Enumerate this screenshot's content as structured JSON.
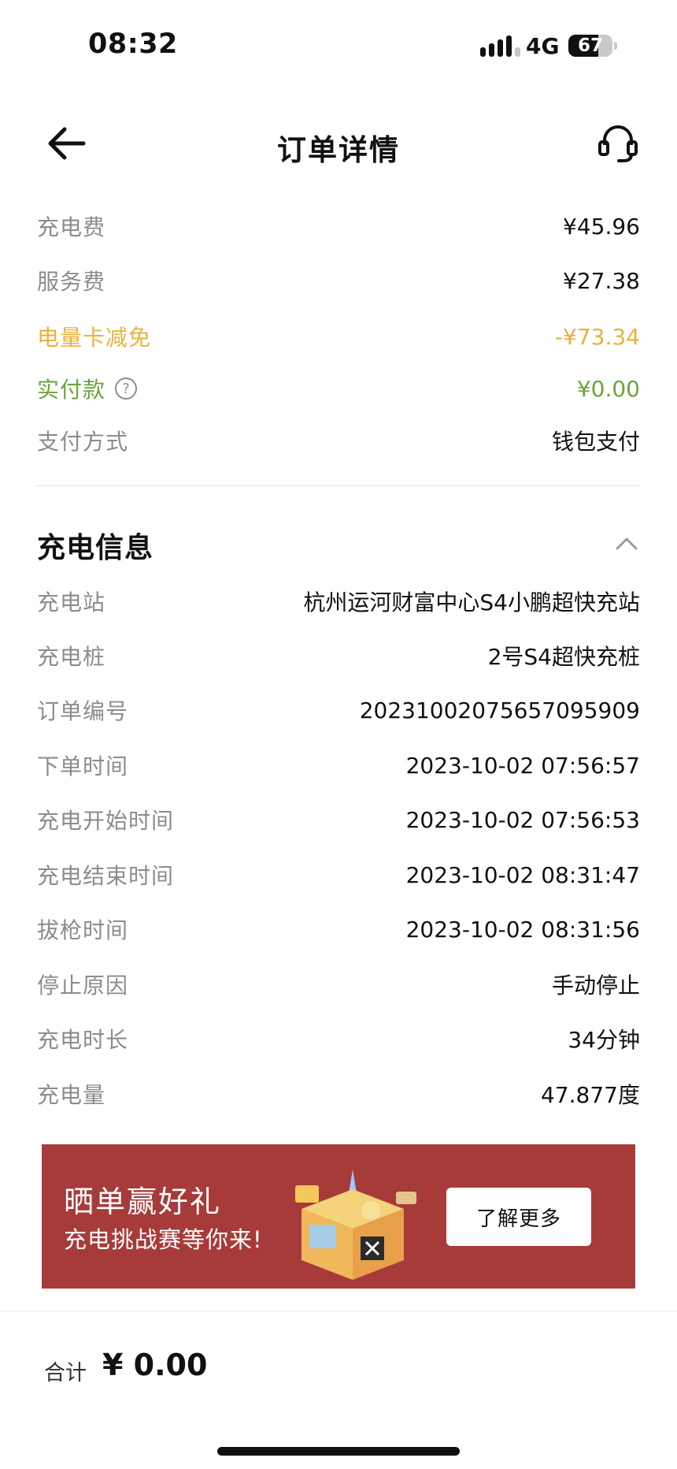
{
  "status_bar": {
    "time": "08:32",
    "network": "4G",
    "battery": "67",
    "battery_level": 0.67
  },
  "nav": {
    "title": "订单详情",
    "back_icon": "arrow-left-icon",
    "service_icon": "headset-icon"
  },
  "fees": {
    "charge_fee": {
      "label": "充电费",
      "value": "¥45.96"
    },
    "service_fee": {
      "label": "服务费",
      "value": "¥27.38"
    },
    "discount": {
      "label": "电量卡减免",
      "value": "-¥73.34"
    },
    "paid": {
      "label": "实付款",
      "value": "¥0.00",
      "help_icon": "question-circle-icon",
      "help_glyph": "?"
    },
    "payment_method": {
      "label": "支付方式",
      "value": "钱包支付"
    }
  },
  "charging_info": {
    "title": "充电信息",
    "collapse_icon": "chevron-up-icon",
    "rows": [
      {
        "label": "充电站",
        "value": "杭州运河财富中心S4小鹏超快充站"
      },
      {
        "label": "充电桩",
        "value": "2号S4超快充桩"
      },
      {
        "label": "订单编号",
        "value": "20231002075657095909"
      },
      {
        "label": "下单时间",
        "value": "2023-10-02 07:56:57"
      },
      {
        "label": "充电开始时间",
        "value": "2023-10-02 07:56:53"
      },
      {
        "label": "充电结束时间",
        "value": "2023-10-02 08:31:47"
      },
      {
        "label": "拔枪时间",
        "value": "2023-10-02 08:31:56"
      },
      {
        "label": "停止原因",
        "value": "手动停止"
      },
      {
        "label": "充电时长",
        "value": "34分钟"
      },
      {
        "label": "充电量",
        "value": "47.877度"
      }
    ]
  },
  "banner": {
    "title": "晒单赢好礼",
    "subtitle": "充电挑战赛等你来!",
    "button_label": "了解更多",
    "background": "#a63b3a"
  },
  "footer": {
    "total_label": "合计",
    "total_value": "¥ 0.00"
  },
  "colors": {
    "discount": "#e8b23c",
    "paid": "#6aa53d",
    "label_gray": "#8c8c8c"
  }
}
